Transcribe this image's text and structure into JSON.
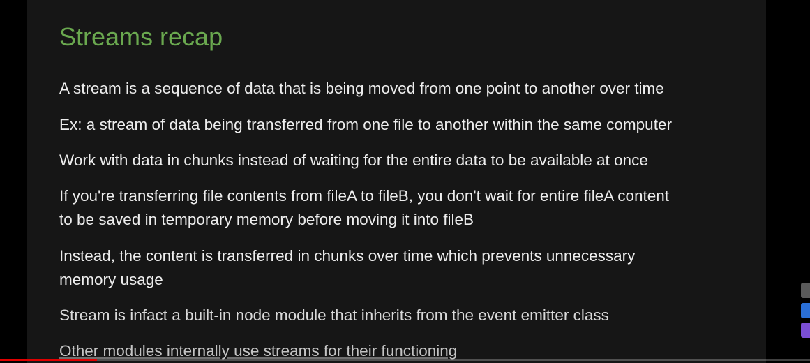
{
  "slide": {
    "title": "Streams recap",
    "bullets": [
      {
        "lines": [
          "A stream is a sequence of data that is being moved from one point to another over time"
        ]
      },
      {
        "lines": [
          "Ex: a stream of data being transferred from one file to another within the same computer"
        ]
      },
      {
        "lines": [
          "Work with data in chunks instead of waiting for the entire data to be available at once"
        ]
      },
      {
        "lines": [
          "If you're transferring file contents from fileA to fileB, you don't wait for entire fileA content",
          "to be saved in temporary memory before moving it into fileB"
        ]
      },
      {
        "lines": [
          "Instead, the content is transferred in chunks over time which prevents unnecessary",
          "memory usage"
        ]
      },
      {
        "lines": [
          "Stream is infact a built-in node module that inherits from the event emitter class"
        ]
      },
      {
        "lines": [
          "Other modules internally use streams for their functioning"
        ]
      }
    ]
  },
  "player": {
    "progress_fraction": 0.12,
    "colors": {
      "progress": "#e00000",
      "title": "#6aa84f"
    }
  }
}
